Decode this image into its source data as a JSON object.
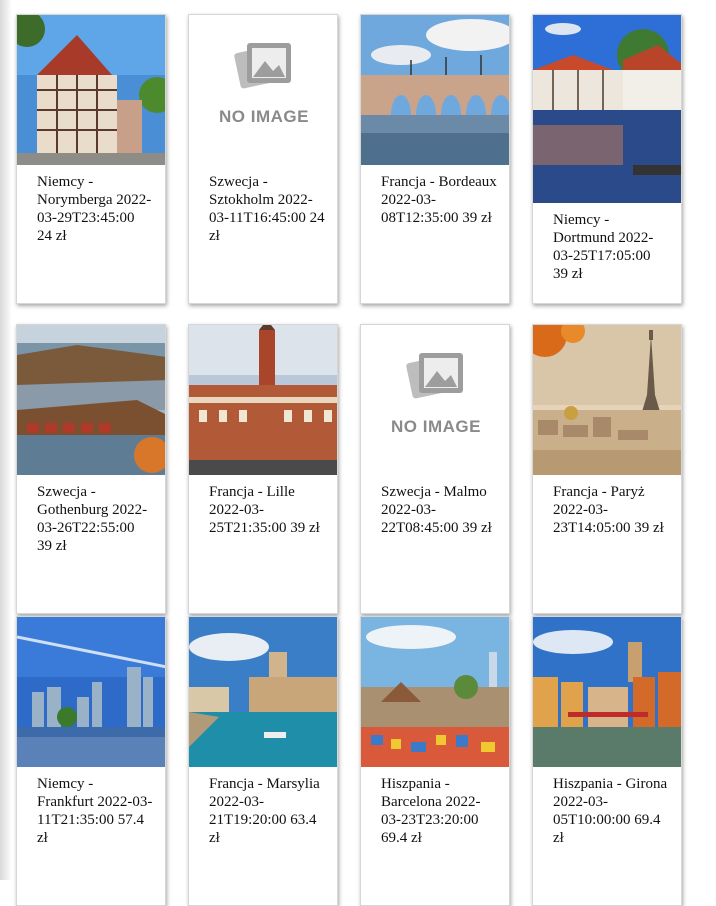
{
  "no_image_text": "NO IMAGE",
  "cards": [
    {
      "caption": "Niemcy - Norymberga 2022-03-29T23:45:00 24 zł",
      "image": "nuremberg-timbered-house",
      "has_image": true
    },
    {
      "caption": "Szwecja - Sztokholm 2022-03-11T16:45:00 24 zł",
      "image": "no-image-placeholder",
      "has_image": false
    },
    {
      "caption": "Francja - Bordeaux 2022-03-08T12:35:00 39 zł",
      "image": "bordeaux-stone-bridge",
      "has_image": true
    },
    {
      "caption": "Niemcy - Dortmund 2022-03-25T17:05:00 39 zł",
      "image": "dortmund-castle-pond",
      "has_image": true
    },
    {
      "caption": "Szwecja - Gothenburg 2022-03-26T22:55:00 39 zł",
      "image": "gothenburg-archipelago",
      "has_image": true
    },
    {
      "caption": "Francja - Lille 2022-03-25T21:35:00 39 zł",
      "image": "lille-belfry-square",
      "has_image": true
    },
    {
      "caption": "Szwecja - Malmo 2022-03-22T08:45:00 39 zł",
      "image": "no-image-placeholder",
      "has_image": false
    },
    {
      "caption": "Francja - Paryż 2022-03-23T14:05:00 39 zł",
      "image": "paris-eiffel-tower",
      "has_image": true
    },
    {
      "caption": "Niemcy - Frankfurt 2022-03-11T21:35:00 57.4 zł",
      "image": "frankfurt-skyline",
      "has_image": true
    },
    {
      "caption": "Francja - Marsylia 2022-03-21T19:20:00 63.4 zł",
      "image": "marseille-harbor-fort",
      "has_image": true
    },
    {
      "caption": "Hiszpania - Barcelona 2022-03-23T23:20:00 69.4 zł",
      "image": "barcelona-park-guell",
      "has_image": true
    },
    {
      "caption": "Hiszpania - Girona 2022-03-05T10:00:00 69.4 zł",
      "image": "girona-river-houses",
      "has_image": true
    }
  ]
}
